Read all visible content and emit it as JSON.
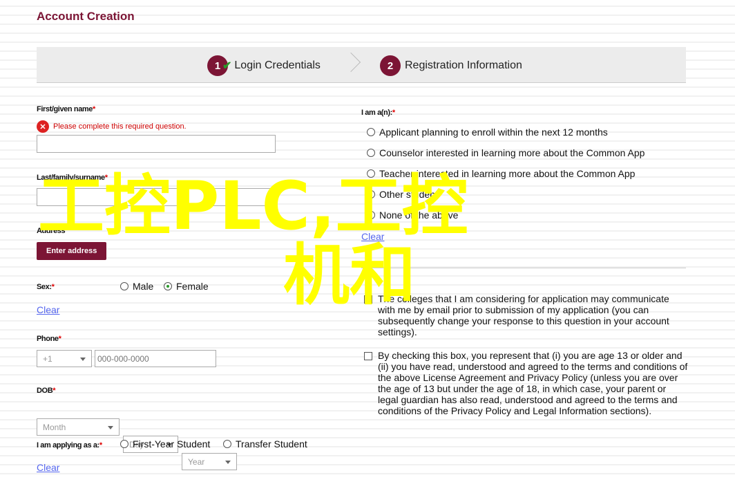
{
  "title": "Account Creation",
  "steps": [
    {
      "num": "1",
      "label": "Login Credentials",
      "done": true
    },
    {
      "num": "2",
      "label": "Registration Information"
    }
  ],
  "left": {
    "first_name": {
      "label": "First/given name",
      "error": "Please complete this required question.",
      "value": ""
    },
    "last_name": {
      "label": "Last/family/surname",
      "value": ""
    },
    "address": {
      "label": "Address",
      "button": "Enter address"
    },
    "sex": {
      "label": "Sex:",
      "options": [
        "Male",
        "Female"
      ],
      "selected": "Female",
      "clear": "Clear"
    },
    "phone": {
      "label": "Phone",
      "code": "+1",
      "placeholder": "000-000-0000"
    },
    "dob": {
      "label": "DOB",
      "month": "Month",
      "day": "Day",
      "year": "Year"
    },
    "applying": {
      "label": "I am applying as a:",
      "options": [
        "First-Year Student",
        "Transfer Student"
      ],
      "clear": "Clear"
    }
  },
  "right": {
    "iam": {
      "label": "I am a(n):",
      "options": [
        "Applicant planning to enroll within the next 12 months",
        "Counselor interested in learning more about the Common App",
        "Teacher interested in learning more about the Common App",
        "Other student",
        "None of the above"
      ],
      "clear": "Clear"
    },
    "consent1": {
      "checked": true,
      "text": "The colleges that I am considering for application may communicate with me by email prior to submission of my application (you can subsequently change your response to this question in your account settings)."
    },
    "consent2": {
      "checked": false,
      "text": "By checking this box, you represent that (i) you are age 13 or older and (ii) you have read, understood and agreed to the terms and conditions of the above License Agreement and Privacy Policy (unless you are over the age of 13 but under the age of 18, in which case, your parent or legal guardian has also read, understood and agreed to the terms and conditions of the Privacy Policy and Legal Information sections)."
    }
  },
  "watermark": {
    "line1": "工控PLC,工控",
    "line2": "机和"
  },
  "colors": {
    "brand": "#7c1535",
    "error": "#cc0000",
    "watermark": "#ffff00",
    "link": "#5566ee"
  }
}
